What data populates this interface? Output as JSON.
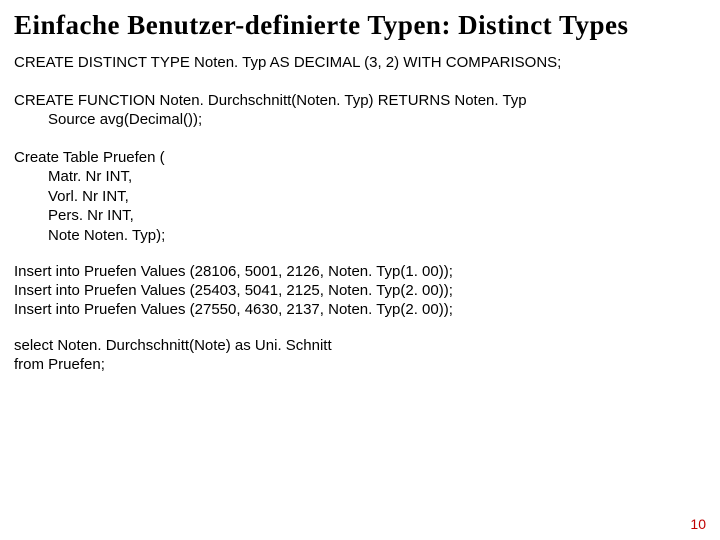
{
  "title": "Einfache Benutzer-definierte Typen: Distinct Types",
  "stmt1": "CREATE DISTINCT TYPE Noten. Typ AS DECIMAL (3, 2) WITH COMPARISONS;",
  "stmt2": {
    "l1": "CREATE FUNCTION Noten. Durchschnitt(Noten. Typ) RETURNS Noten. Typ",
    "l2": "Source avg(Decimal());"
  },
  "stmt3": {
    "l1": "Create Table Pruefen (",
    "l2": "Matr. Nr INT,",
    "l3": "Vorl. Nr INT,",
    "l4": "Pers. Nr INT,",
    "l5": "Note Noten. Typ);"
  },
  "stmt4": {
    "l1": "Insert into Pruefen Values (28106, 5001, 2126, Noten. Typ(1. 00));",
    "l2": "Insert into Pruefen Values (25403, 5041, 2125, Noten. Typ(2. 00));",
    "l3": "Insert into Pruefen Values (27550, 4630, 2137, Noten. Typ(2. 00));"
  },
  "stmt5": {
    "l1": "select Noten. Durchschnitt(Note) as Uni. Schnitt",
    "l2": "from Pruefen;"
  },
  "page_number": "10"
}
